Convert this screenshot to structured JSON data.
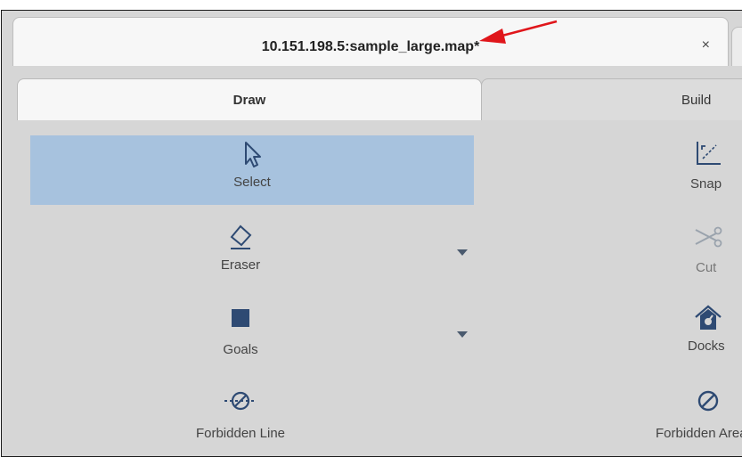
{
  "file_tab": {
    "title": "10.151.198.5:sample_large.map*",
    "close": "×"
  },
  "subtabs": [
    {
      "label": "Draw",
      "active": true
    },
    {
      "label": "Build",
      "active": false
    }
  ],
  "tools_left": [
    {
      "label": "Select",
      "icon": "cursor-arrow-icon",
      "selected": true
    },
    {
      "label": "Eraser",
      "icon": "eraser-icon",
      "has_dropdown": true
    },
    {
      "label": "Goals",
      "icon": "filled-square-icon",
      "has_dropdown": true
    },
    {
      "label": "Forbidden Line",
      "icon": "forbidden-line-icon"
    }
  ],
  "tools_right": [
    {
      "label": "Snap",
      "icon": "snap-icon"
    },
    {
      "label": "Cut",
      "icon": "scissors-icon"
    },
    {
      "label": "Docks",
      "icon": "dock-house-icon"
    },
    {
      "label": "Forbidden Area",
      "icon": "forbidden-area-icon"
    }
  ],
  "colors": {
    "selected_bg": "#a7c2de",
    "icon_blue": "#2e4a73",
    "annotation_red": "#e0161b"
  }
}
